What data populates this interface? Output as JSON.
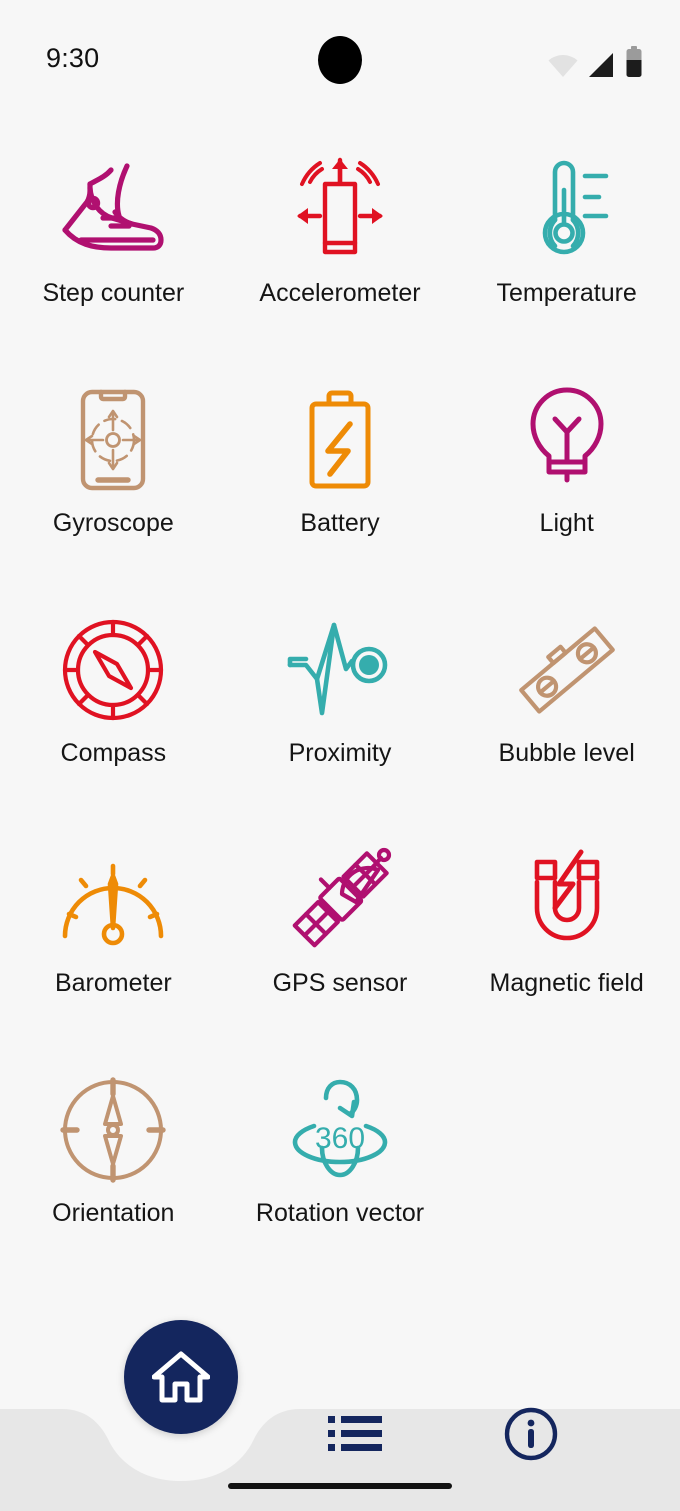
{
  "status_bar": {
    "time": "9:30",
    "wifi_icon": "wifi-icon",
    "signal_icon": "cellular-signal-icon",
    "battery_icon": "battery-icon",
    "camera_icon": "camera-punch-hole"
  },
  "colors": {
    "background": "#F7F7F7",
    "magenta": "#B01070",
    "red": "#E01222",
    "teal": "#35ADAD",
    "tan": "#C09471",
    "orange": "#EE8B06",
    "navy": "#14265E",
    "nav_bar": "#E7E7E7",
    "label": "#151515"
  },
  "sensors": [
    {
      "label": "Step counter",
      "icon": "shoe-icon",
      "color": "#B01070"
    },
    {
      "label": "Accelerometer",
      "icon": "accelerometer-icon",
      "color": "#E01222"
    },
    {
      "label": "Temperature",
      "icon": "thermometer-icon",
      "color": "#35ADAD"
    },
    {
      "label": "Gyroscope",
      "icon": "gyroscope-icon",
      "color": "#C09471"
    },
    {
      "label": "Battery",
      "icon": "battery-bolt-icon",
      "color": "#EE8B06"
    },
    {
      "label": "Light",
      "icon": "light-bulb-icon",
      "color": "#B01070"
    },
    {
      "label": "Compass",
      "icon": "compass-icon",
      "color": "#E01222"
    },
    {
      "label": "Proximity",
      "icon": "proximity-wave-icon",
      "color": "#35ADAD"
    },
    {
      "label": "Bubble level",
      "icon": "spirit-level-icon",
      "color": "#C09471"
    },
    {
      "label": "Barometer",
      "icon": "gauge-icon",
      "color": "#EE8B06"
    },
    {
      "label": "GPS sensor",
      "icon": "satellite-icon",
      "color": "#B01070"
    },
    {
      "label": "Magnetic field",
      "icon": "magnet-icon",
      "color": "#E01222"
    },
    {
      "label": "Orientation",
      "icon": "orientation-icon",
      "color": "#C09471"
    },
    {
      "label": "Rotation vector",
      "icon": "rotation-360-icon",
      "color": "#35ADAD",
      "badge": "360"
    }
  ],
  "bottom_nav": {
    "home_icon": "home-icon",
    "list_icon": "list-icon",
    "info_icon": "info-icon"
  }
}
